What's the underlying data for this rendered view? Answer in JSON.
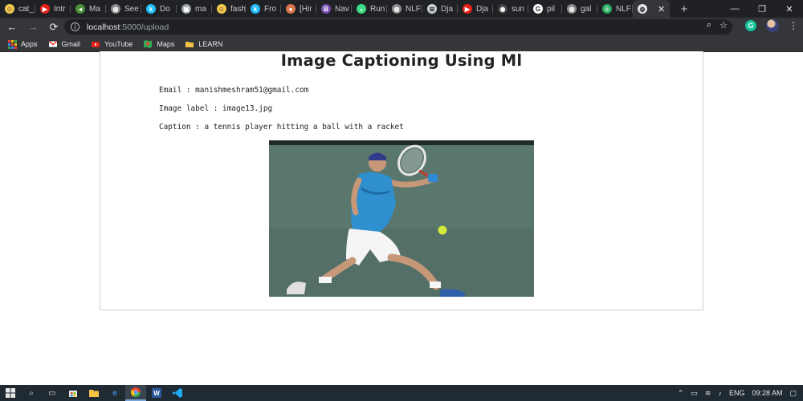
{
  "browser": {
    "tabs": [
      {
        "label": "cat_",
        "icon": "smiley-icon",
        "color": "#f2c94c"
      },
      {
        "label": "Intr",
        "icon": "youtube-icon",
        "color": "#e62117"
      },
      {
        "label": "Ma",
        "icon": "slides-icon",
        "color": "#4a8f3a"
      },
      {
        "label": "See",
        "icon": "globe-icon",
        "color": "#8a8a8a"
      },
      {
        "label": "Do",
        "icon": "kaggle-icon",
        "color": "#20beff"
      },
      {
        "label": "ma",
        "icon": "image-icon",
        "color": "#9aa3ad"
      },
      {
        "label": "fash",
        "icon": "smiley-icon",
        "color": "#f2c94c"
      },
      {
        "label": "Fro",
        "icon": "kaggle-icon",
        "color": "#20beff"
      },
      {
        "label": "[Hir",
        "icon": "avatar-icon",
        "color": "#d9754a"
      },
      {
        "label": "Nav",
        "icon": "bootstrap-icon",
        "color": "#7952b3"
      },
      {
        "label": "Run",
        "icon": "android-icon",
        "color": "#3ddc84"
      },
      {
        "label": "NLF",
        "icon": "globe-icon",
        "color": "#8a8a8a"
      },
      {
        "label": "Dja",
        "icon": "django-icon",
        "color": "#cfd8dc"
      },
      {
        "label": "Dja",
        "icon": "youtube-icon",
        "color": "#e62117"
      },
      {
        "label": "sun",
        "icon": "github-icon",
        "color": "#444444"
      },
      {
        "label": "pil",
        "icon": "google-icon",
        "color": "#ffffff"
      },
      {
        "label": "gal",
        "icon": "globe-icon",
        "color": "#8a8a8a"
      },
      {
        "label": "NLF",
        "icon": "leaf-icon",
        "color": "#27ae60"
      }
    ],
    "active_tab": {
      "label": "",
      "icon": "globe-icon",
      "close": "✕"
    },
    "new_tab": "+",
    "window_controls": {
      "minimize": "—",
      "restore": "❐",
      "close": "✕"
    },
    "address": {
      "host": "localhost",
      "path": ":5000/upload"
    },
    "extensions": {
      "grammarly": "G"
    },
    "bookmarks": [
      {
        "label": "Apps",
        "icon": "apps-grid-icon"
      },
      {
        "label": "Gmail",
        "icon": "gmail-icon"
      },
      {
        "label": "YouTube",
        "icon": "youtube-icon"
      },
      {
        "label": "Maps",
        "icon": "maps-icon"
      },
      {
        "label": "LEARN",
        "icon": "folder-icon"
      }
    ]
  },
  "page": {
    "title": "Image Captioning Using Ml",
    "email_line": "Email : manishmeshram51@gmail.com",
    "label_line": "Image label : image13.jpg",
    "caption_line": "Caption : a tennis player hitting a ball with a racket"
  },
  "taskbar": {
    "apps": [
      "start-icon",
      "search-icon",
      "task-view-icon",
      "store-icon",
      "file-explorer-icon",
      "edge-icon",
      "chrome-icon",
      "word-icon",
      "vscode-icon"
    ],
    "language": "ENG",
    "time": "09:28 AM"
  }
}
